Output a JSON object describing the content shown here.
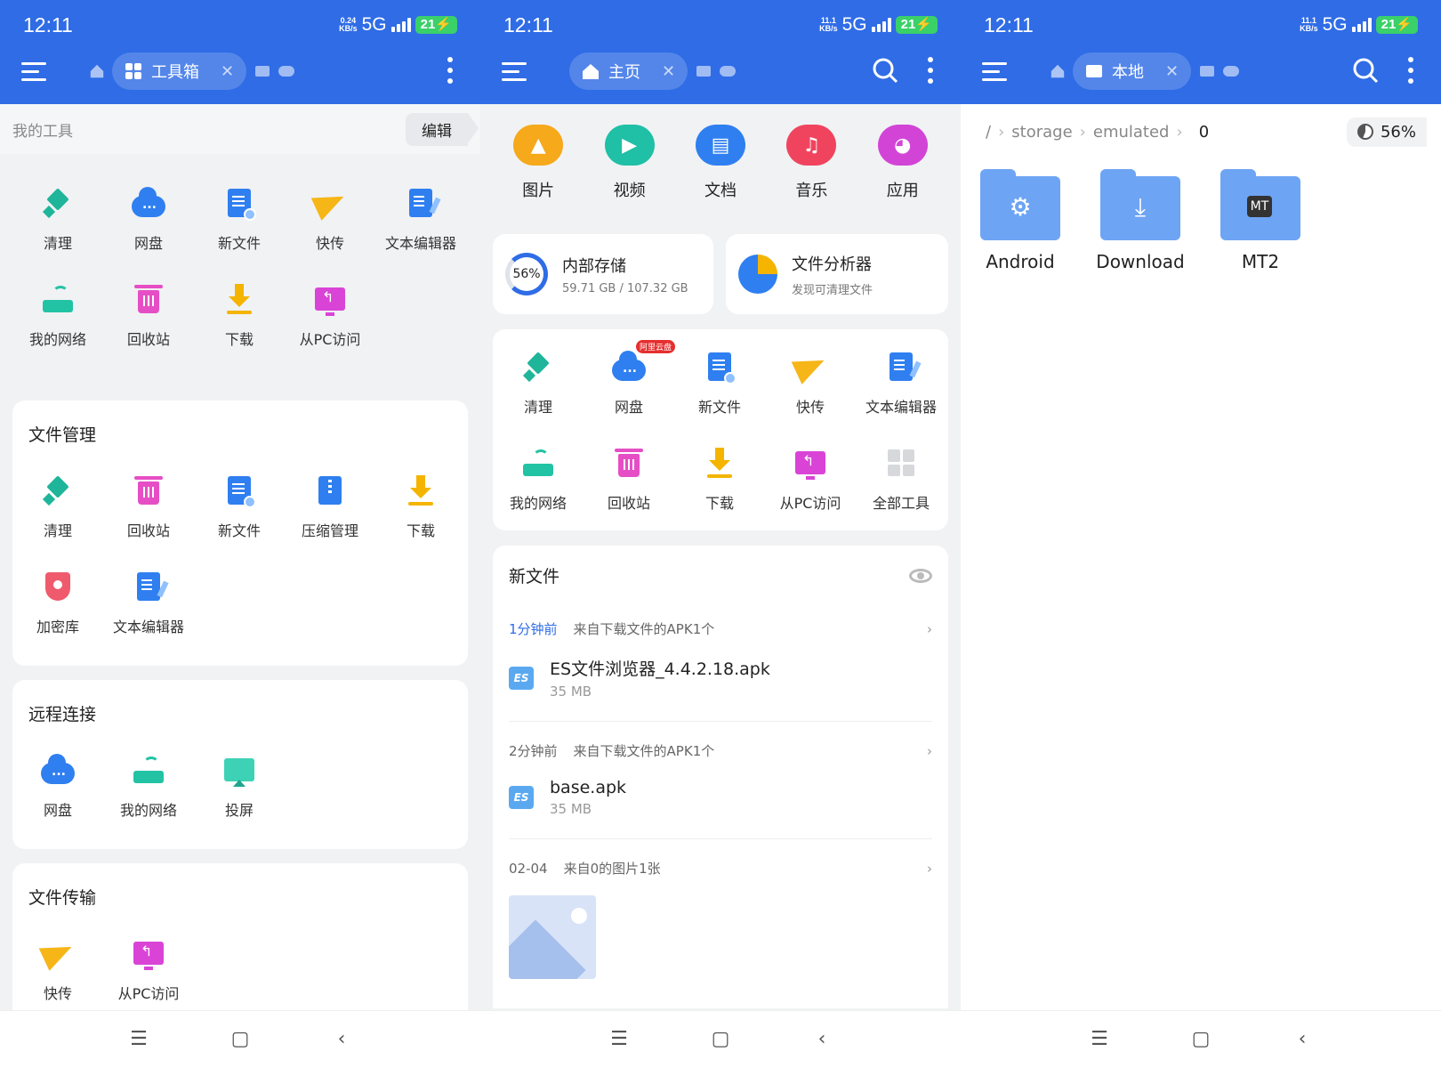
{
  "status": [
    {
      "time": "12:11",
      "speed_top": "0.24",
      "speed_unit": "KB/s",
      "net": "5G",
      "battery": "21"
    },
    {
      "time": "12:11",
      "speed_top": "11.1",
      "speed_unit": "KB/s",
      "net": "5G",
      "battery": "21"
    },
    {
      "time": "12:11",
      "speed_top": "11.1",
      "speed_unit": "KB/s",
      "net": "5G",
      "battery": "21"
    }
  ],
  "tabs": {
    "toolbox": "工具箱",
    "home": "主页",
    "local": "本地"
  },
  "p1": {
    "my_tools_label": "我的工具",
    "edit_label": "编辑",
    "my_tools": [
      {
        "label": "清理",
        "icon": "broom-icon"
      },
      {
        "label": "网盘",
        "icon": "cloud-icon"
      },
      {
        "label": "新文件",
        "icon": "new-file-icon"
      },
      {
        "label": "快传",
        "icon": "paper-plane-icon"
      },
      {
        "label": "文本编辑器",
        "icon": "text-editor-icon"
      },
      {
        "label": "我的网络",
        "icon": "router-icon"
      },
      {
        "label": "回收站",
        "icon": "trash-icon"
      },
      {
        "label": "下载",
        "icon": "download-icon"
      },
      {
        "label": "从PC访问",
        "icon": "pc-access-icon"
      }
    ],
    "file_mgmt_title": "文件管理",
    "file_mgmt": [
      {
        "label": "清理"
      },
      {
        "label": "回收站"
      },
      {
        "label": "新文件"
      },
      {
        "label": "压缩管理"
      },
      {
        "label": "下载"
      },
      {
        "label": "加密库"
      },
      {
        "label": "文本编辑器"
      }
    ],
    "remote_title": "远程连接",
    "remote": [
      {
        "label": "网盘"
      },
      {
        "label": "我的网络"
      },
      {
        "label": "投屏"
      }
    ],
    "transfer_title": "文件传输",
    "transfer": [
      {
        "label": "快传"
      },
      {
        "label": "从PC访问"
      }
    ]
  },
  "p2": {
    "cats": [
      {
        "label": "图片",
        "color": "#f5a91b"
      },
      {
        "label": "视频",
        "color": "#1fc0a5"
      },
      {
        "label": "文档",
        "color": "#2f7ff0"
      },
      {
        "label": "音乐",
        "color": "#f0445e"
      },
      {
        "label": "应用",
        "color": "#d244d6"
      }
    ],
    "storage": {
      "pct": "56%",
      "title": "内部存储",
      "detail": "59.71 GB / 107.32 GB"
    },
    "analyzer": {
      "title": "文件分析器",
      "sub": "发现可清理文件"
    },
    "tools": [
      {
        "label": "清理"
      },
      {
        "label": "网盘",
        "badge": "阿里云盘"
      },
      {
        "label": "新文件"
      },
      {
        "label": "快传"
      },
      {
        "label": "文本编辑器"
      },
      {
        "label": "我的网络"
      },
      {
        "label": "回收站"
      },
      {
        "label": "下载"
      },
      {
        "label": "从PC访问"
      },
      {
        "label": "全部工具"
      }
    ],
    "new_files_title": "新文件",
    "groups": [
      {
        "when": "1分钟前",
        "desc": "来自下载文件的APK1个",
        "file": "ES文件浏览器_4.4.2.18.apk",
        "size": "35 MB"
      },
      {
        "when": "2分钟前",
        "desc": "来自下载文件的APK1个",
        "file": "base.apk",
        "size": "35 MB"
      },
      {
        "when": "02-04",
        "desc": "来自0的图片1张"
      }
    ],
    "es_label": "ES"
  },
  "p3": {
    "crumb_root": "/",
    "crumbs": [
      "storage",
      "emulated",
      "0"
    ],
    "pct": "56%",
    "folders": [
      {
        "label": "Android"
      },
      {
        "label": "Download"
      },
      {
        "label": "MT2"
      }
    ]
  }
}
